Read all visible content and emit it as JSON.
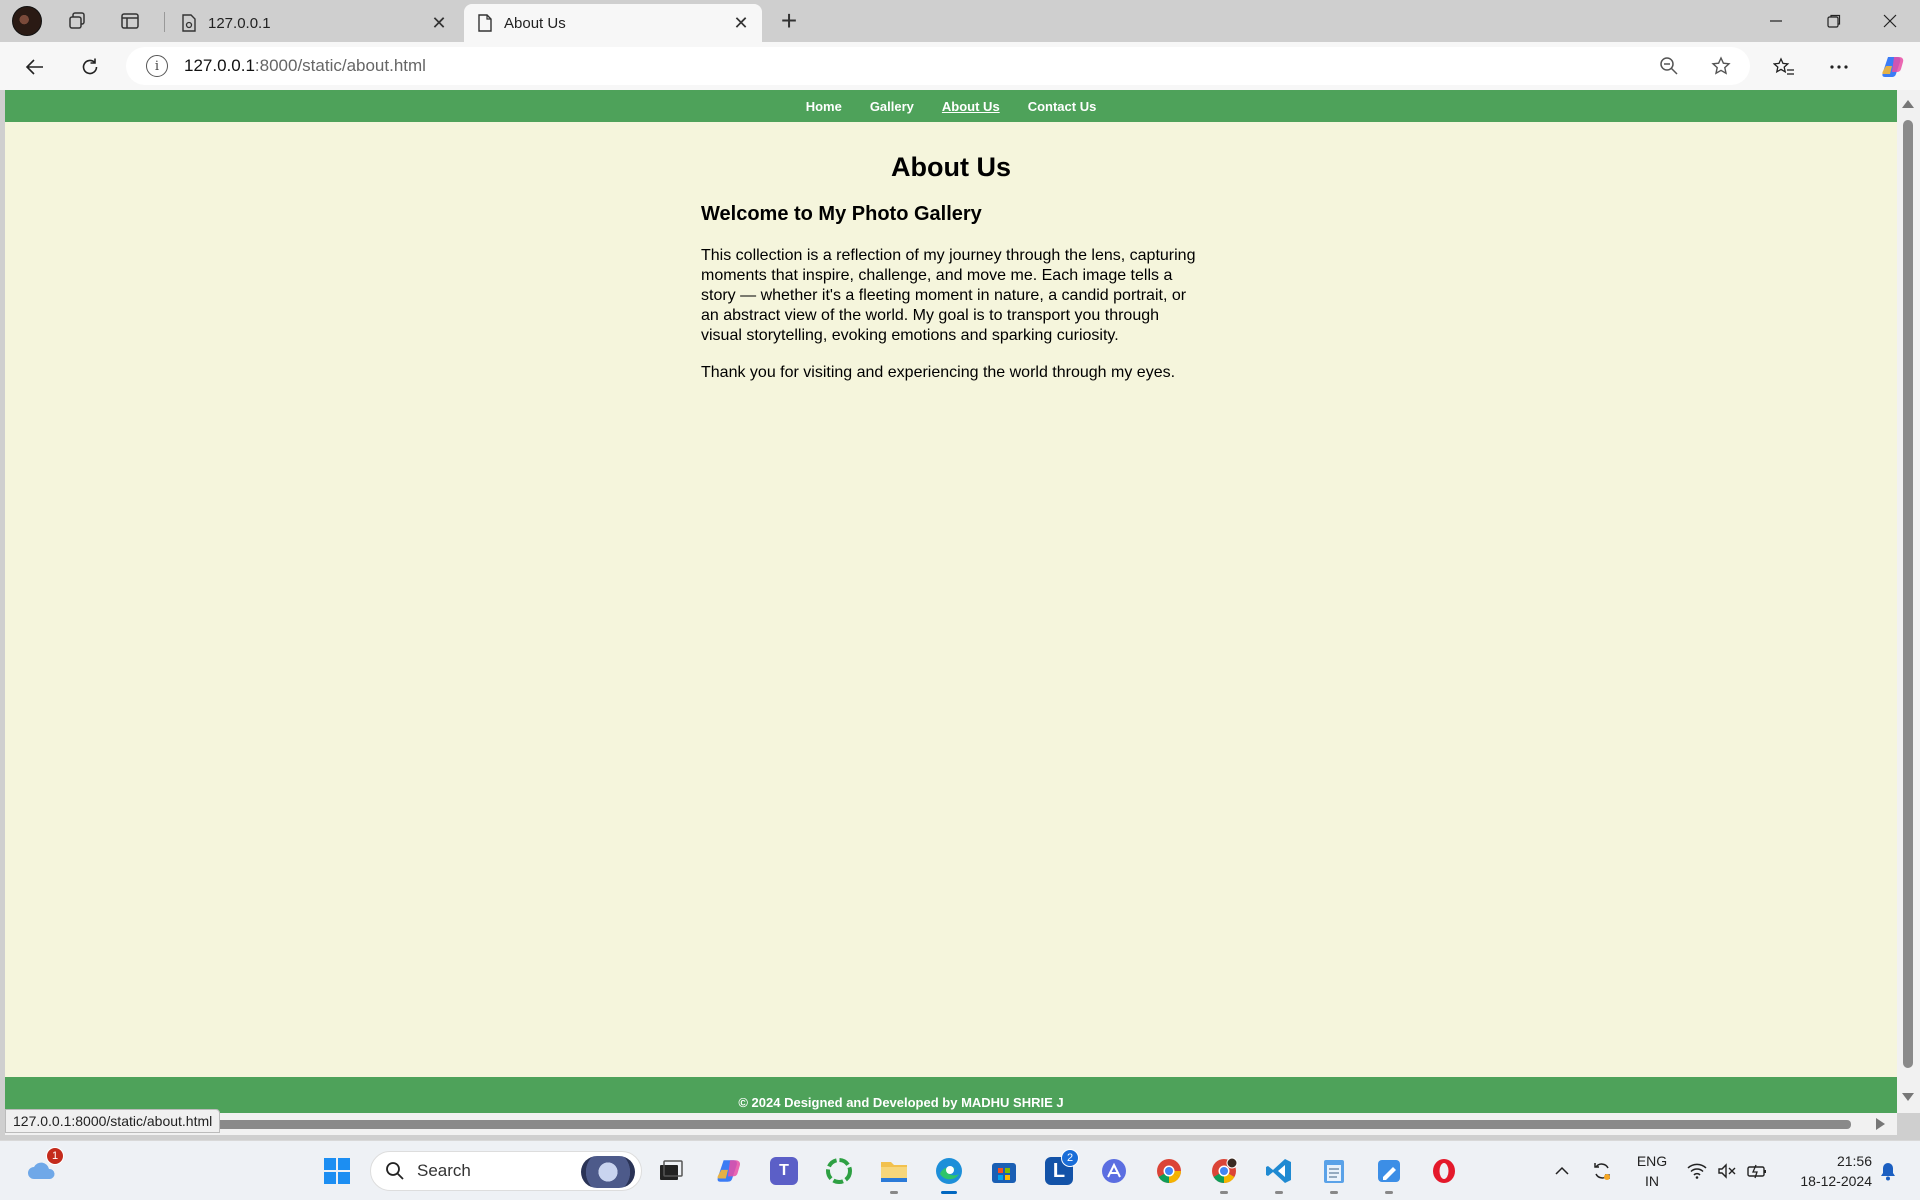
{
  "browser": {
    "tabs": [
      {
        "title": "127.0.0.1",
        "icon": "page-gear-icon",
        "active": false
      },
      {
        "title": "About Us",
        "icon": "page-icon",
        "active": true
      }
    ],
    "address": {
      "host": "127.0.0.1",
      "path": ":8000/static/about.html"
    },
    "status_url": "127.0.0.1:8000/static/about.html"
  },
  "site": {
    "nav": [
      {
        "label": "Home",
        "current": false
      },
      {
        "label": "Gallery",
        "current": false
      },
      {
        "label": "About Us",
        "current": true
      },
      {
        "label": "Contact Us",
        "current": false
      }
    ],
    "heading": "About Us",
    "subheading": "Welcome to My Photo Gallery",
    "paragraphs": [
      "This collection is a reflection of my journey through the lens, capturing moments that inspire, challenge, and move me. Each image tells a story — whether it's a fleeting moment in nature, a candid portrait, or an abstract view of the world. My goal is to transport you through visual storytelling, evoking emotions and sparking curiosity.",
      "Thank you for visiting and experiencing the world through my eyes."
    ],
    "footer": "© 2024 Designed and Developed by MADHU SHRIE J",
    "colors": {
      "nav": "#4ea25a",
      "background": "#f5f5dc"
    }
  },
  "taskbar": {
    "search_label": "Search",
    "weather_badge": "1",
    "l_app_badge": "2",
    "language": {
      "line1": "ENG",
      "line2": "IN"
    },
    "clock": {
      "time": "21:56",
      "date": "18-12-2024"
    }
  }
}
